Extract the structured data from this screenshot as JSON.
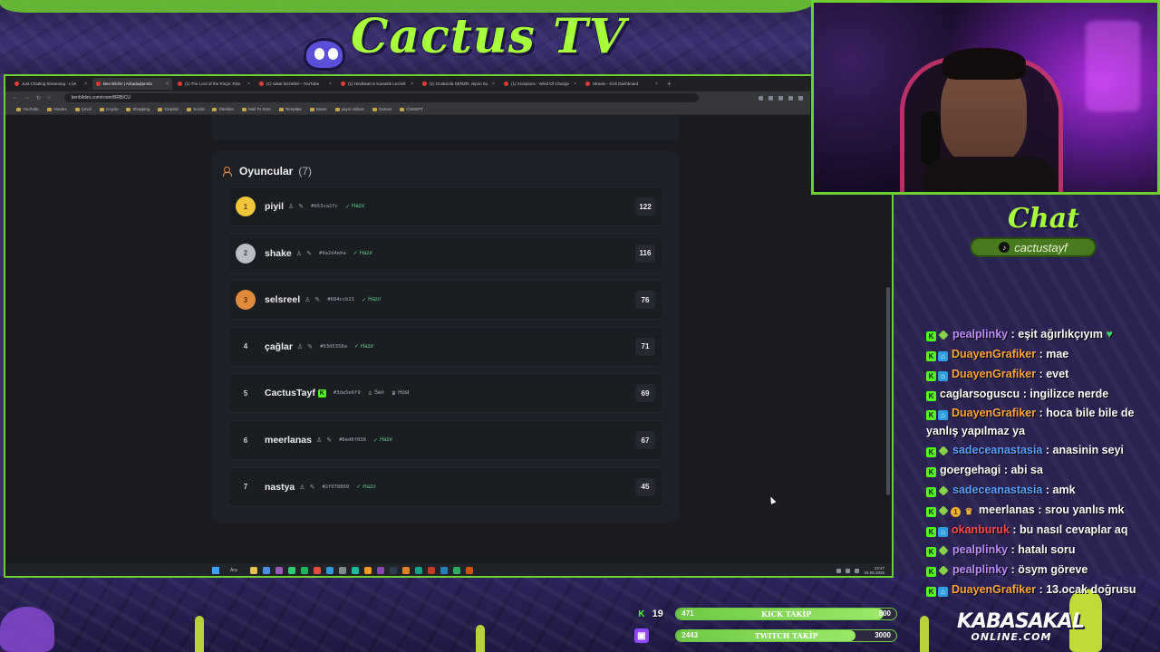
{
  "overlay": {
    "logo_text": "Cactus TV",
    "chat_title": "Chat",
    "tiktok_handle": "cactustayf",
    "brand_line1": "KABASAKAL",
    "brand_line2": "ONLINE.COM"
  },
  "browser": {
    "tabs": [
      {
        "title": "Just Chatting Streaming - Live",
        "active": false
      },
      {
        "title": "Ben Bildim | Arkadaşlarınla",
        "active": true
      },
      {
        "title": "(1) The Lord of the Rings: Rise",
        "active": false
      },
      {
        "title": "(1) sakat lezzetleri - YouTube",
        "active": false
      },
      {
        "title": "(1) Hindistan'ın Karanlık Lezzetl",
        "active": false
      },
      {
        "title": "(1) Ocaksi'da DERZİK Jepon Su",
        "active": false
      },
      {
        "title": "(1) Scorpions - Wind Of Change",
        "active": false
      },
      {
        "title": "Stream - Kick Dashboard",
        "active": false
      }
    ],
    "url": "benbildim.com/room/BRBICU",
    "bookmarks": [
      "YouTube",
      "Yandex",
      "Çeviri",
      "Crypto",
      "Shopping",
      "Graphic",
      "Social",
      "İzlenilen",
      "Mail To Sam",
      "Template",
      "Music",
      "yayın videos",
      "Games",
      "ChatGPT"
    ]
  },
  "players": {
    "heading": "Oyuncular",
    "count": "(7)",
    "list": [
      {
        "rank": "1",
        "name": "piyil",
        "hash": "#b53ca2fc",
        "status": "Hazır",
        "score": "122",
        "medal": "gold"
      },
      {
        "rank": "2",
        "name": "shake",
        "hash": "#9a2d4eba",
        "status": "Hazır",
        "score": "116",
        "medal": "silver"
      },
      {
        "rank": "3",
        "name": "selsreel",
        "hash": "#684ccb21",
        "status": "Hazır",
        "score": "76",
        "medal": "bronze"
      },
      {
        "rank": "4",
        "name": "çağlar",
        "hash": "#93d5358a",
        "status": "Hazır",
        "score": "71",
        "medal": ""
      },
      {
        "rank": "5",
        "name": "CactusTayf",
        "hash": "#3da5e6f9",
        "status": "Sen",
        "status2": "Host",
        "score": "69",
        "medal": ""
      },
      {
        "rank": "6",
        "name": "meerlanas",
        "hash": "#6ed6f030",
        "status": "Hazır",
        "score": "67",
        "medal": ""
      },
      {
        "rank": "7",
        "name": "nastya",
        "hash": "#2f078869",
        "status": "Hazır",
        "score": "45",
        "medal": ""
      }
    ]
  },
  "taskbar": {
    "search_label": "Ara",
    "time": "23:47",
    "date": "25.08.2025"
  },
  "chat": [
    {
      "user": "pealplinky",
      "color": "#c08cff",
      "platform": "kick",
      "badge": "sub",
      "text": " : eşit ağırlıkçıyım ",
      "extra": "♥"
    },
    {
      "user": "DuayenGrafiker",
      "color": "#ffa63a",
      "platform": "kick",
      "badge": "twitch",
      "text": " : mae"
    },
    {
      "user": "DuayenGrafiker",
      "color": "#ffa63a",
      "platform": "kick",
      "badge": "twitch",
      "text": " : evet"
    },
    {
      "user": "caglarsoguscu",
      "color": "#ffffff",
      "platform": "kick",
      "badge": "",
      "text": " : ingilizce nerde"
    },
    {
      "user": "DuayenGrafiker",
      "color": "#ffa63a",
      "platform": "kick",
      "badge": "twitch",
      "text": " : hoca bile bile de yanlış yapılmaz ya",
      "wrap": true
    },
    {
      "user": "sadeceanastasia",
      "color": "#5aa0ff",
      "platform": "kick",
      "badge": "sub",
      "text": " : anasinin seyi"
    },
    {
      "user": "goergehagi",
      "color": "#ffffff",
      "platform": "kick",
      "badge": "",
      "text": " : abi sa"
    },
    {
      "user": "sadeceanastasia",
      "color": "#5aa0ff",
      "platform": "kick",
      "badge": "sub",
      "text": " : amk"
    },
    {
      "user": "meerlanas",
      "color": "#ffffff",
      "platform": "kick",
      "badge": "crown",
      "text": " : srou yanlıs mk"
    },
    {
      "user": "okanburuk",
      "color": "#ff4b4b",
      "platform": "kick",
      "badge": "twitch",
      "text": " : bu nasıl cevaplar aq"
    },
    {
      "user": "pealplinky",
      "color": "#c08cff",
      "platform": "kick",
      "badge": "sub",
      "text": " : hatalı soru"
    },
    {
      "user": "pealplinky",
      "color": "#c08cff",
      "platform": "kick",
      "badge": "sub",
      "text": " : ösym göreve"
    },
    {
      "user": "DuayenGrafiker",
      "color": "#ffa63a",
      "platform": "kick",
      "badge": "twitch",
      "text": " : 13.ocak doğrusu"
    }
  ],
  "goals": [
    {
      "platform": "kick",
      "count": "19",
      "current": "471",
      "label": "KICK TAKİP",
      "max": "500",
      "progress": 0.942,
      "color": "#6ec846"
    },
    {
      "platform": "twitch",
      "count": "",
      "current": "2443",
      "label": "TWITCH TAKİP",
      "max": "3000",
      "progress": 0.814,
      "color": "#6ec846"
    }
  ]
}
